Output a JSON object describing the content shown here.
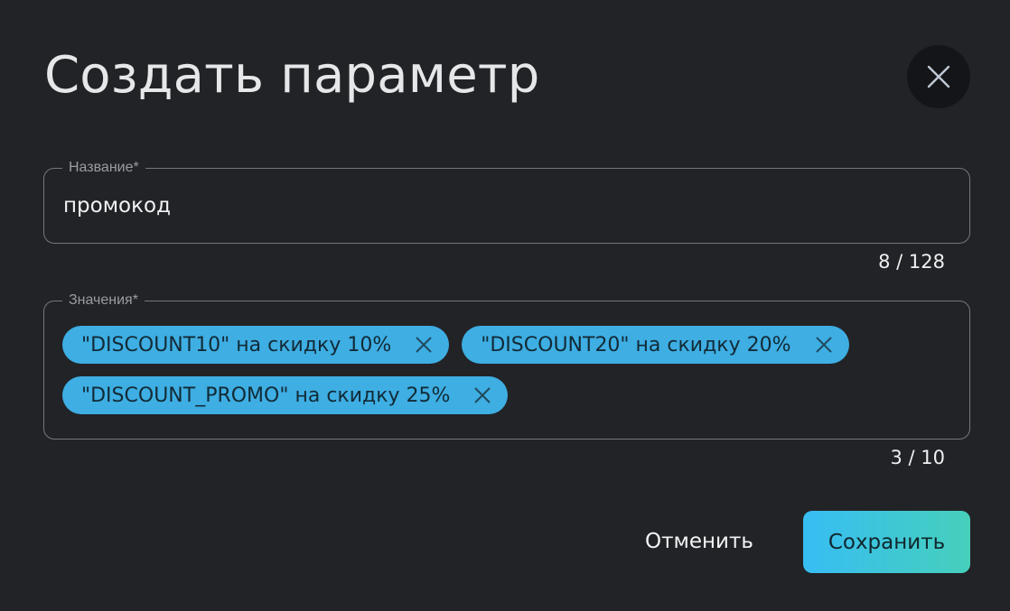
{
  "dialog": {
    "title": "Создать параметр",
    "close_icon": "close-icon"
  },
  "name_field": {
    "label": "Название*",
    "value": "промокод",
    "counter": "8 / 128"
  },
  "values_field": {
    "label": "Значения*",
    "chips": [
      {
        "label": "\"DISCOUNT10\" на скидку 10%"
      },
      {
        "label": "\"DISCOUNT20\" на скидку 20%"
      },
      {
        "label": "\"DISCOUNT_PROMO\" на скидку 25%"
      }
    ],
    "counter": "3 / 10"
  },
  "actions": {
    "cancel_label": "Отменить",
    "save_label": "Сохранить"
  },
  "colors": {
    "background": "#222326",
    "chip": "#3eaee3",
    "save_gradient_start": "#37bdf3",
    "save_gradient_end": "#46d0bb"
  }
}
